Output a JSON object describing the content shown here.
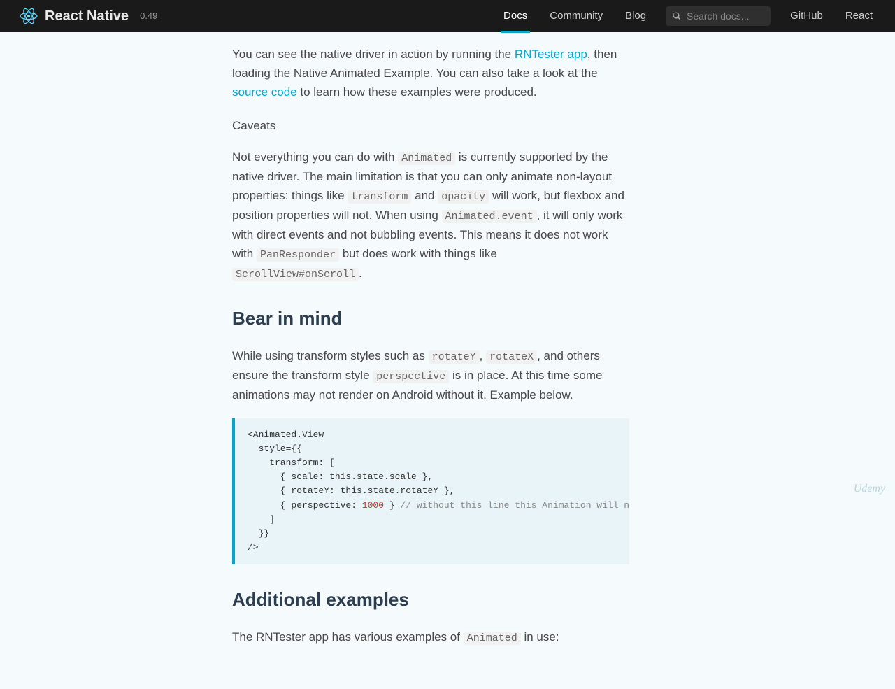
{
  "nav": {
    "brand": "React Native",
    "version": "0.49",
    "links": {
      "docs": "Docs",
      "community": "Community",
      "blog": "Blog",
      "github": "GitHub",
      "react": "React"
    },
    "search_placeholder": "Search docs..."
  },
  "intro": {
    "t1": "You can see the native driver in action by running the ",
    "link1": "RNTester app",
    "t2": ", then loading the Native Animated Example. You can also take a look at the ",
    "link2": "source code",
    "t3": " to learn how these examples were produced."
  },
  "caveats": {
    "heading": "Caveats",
    "t1": "Not everything you can do with ",
    "c1": "Animated",
    "t2": " is currently supported by the native driver. The main limitation is that you can only animate non-layout properties: things like ",
    "c2": "transform",
    "t3": " and ",
    "c3": "opacity",
    "t4": " will work, but flexbox and position properties will not. When using ",
    "c4": "Animated.event",
    "t5": ", it will only work with direct events and not bubbling events. This means it does not work with ",
    "c5": "PanResponder",
    "t6": " but does work with things like ",
    "c6": "ScrollView#onScroll",
    "t7": "."
  },
  "bear": {
    "heading": "Bear in mind",
    "t1": "While using transform styles such as ",
    "c1": "rotateY",
    "t2": ", ",
    "c2": "rotateX",
    "t3": ", and others ensure the transform style ",
    "c3": "perspective",
    "t4": " is in place. At this time some animations may not render on Android without it. Example below."
  },
  "code": {
    "l1": "<Animated.View",
    "l2": "  style={{",
    "l3": "    transform: [",
    "l4": "      { scale: this.state.scale },",
    "l5": "      { rotateY: this.state.rotateY },",
    "l6a": "      { perspective: ",
    "l6num": "1000",
    "l6b": " } ",
    "l6c": "// without this line this Animation will not render on Android while working fine on iOS",
    "l7": "    ]",
    "l8": "  }}",
    "l9": "/>"
  },
  "additional": {
    "heading": "Additional examples",
    "t1": "The RNTester app has various examples of ",
    "c1": "Animated",
    "t2": " in use:"
  },
  "watermark": "Udemy"
}
